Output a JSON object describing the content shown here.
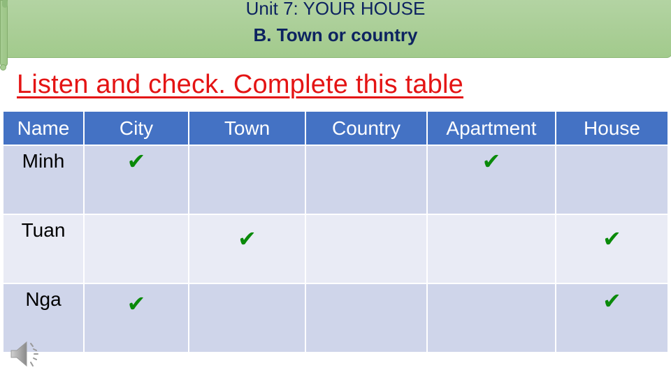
{
  "header": {
    "unit_title": "Unit 7: YOUR HOUSE",
    "section_title": "B. Town or country"
  },
  "instruction": "Listen and check. Complete this table",
  "table": {
    "columns": [
      "Name",
      "City",
      "Town",
      "Country",
      "Apartment",
      "House"
    ],
    "rows": [
      {
        "name": "Minh",
        "cells": [
          "✔",
          "",
          "",
          "✔",
          ""
        ]
      },
      {
        "name": "Tuan",
        "cells": [
          "",
          "✔",
          "",
          "",
          "✔"
        ]
      },
      {
        "name": "Nga",
        "cells": [
          "✔",
          "",
          "",
          "",
          "✔"
        ]
      }
    ]
  },
  "icons": {
    "check": "check-icon",
    "audio": "speaker-icon"
  },
  "colors": {
    "banner": "#a8cd93",
    "title_text": "#0d2360",
    "instruction_text": "#e41414",
    "table_header": "#4472c4",
    "row_odd": "#cfd5ea",
    "row_even": "#e9ebf5",
    "check": "#0a8a0a"
  }
}
